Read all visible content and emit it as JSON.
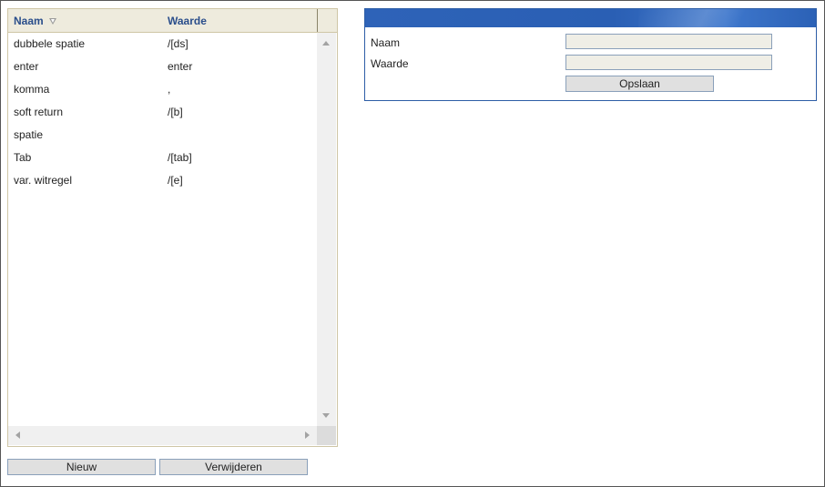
{
  "grid": {
    "columns": [
      {
        "label": "Naam",
        "sorted": "descending"
      },
      {
        "label": "Waarde"
      }
    ],
    "rows": [
      {
        "naam": "dubbele spatie",
        "waarde": "/[ds]"
      },
      {
        "naam": "enter",
        "waarde": "enter"
      },
      {
        "naam": "komma",
        "waarde": ","
      },
      {
        "naam": "soft return",
        "waarde": "/[b]"
      },
      {
        "naam": "spatie",
        "waarde": ""
      },
      {
        "naam": "Tab",
        "waarde": "/[tab]"
      },
      {
        "naam": "var. witregel",
        "waarde": "/[e]"
      }
    ]
  },
  "buttons": {
    "new_label": "Nieuw",
    "delete_label": "Verwijderen"
  },
  "form": {
    "title": "",
    "naam_label": "Naam",
    "naam_value": "",
    "waarde_label": "Waarde",
    "waarde_value": "",
    "save_label": "Opslaan"
  },
  "colors": {
    "header_accent": "#2a5fb4",
    "column_header_text": "#2a4e8b",
    "grid_header_bg": "#eeebdd"
  },
  "icons": {
    "sort": "sort-descending-icon",
    "scroll_up": "arrow-up-icon",
    "scroll_down": "arrow-down-icon",
    "scroll_left": "arrow-left-icon",
    "scroll_right": "arrow-right-icon"
  }
}
